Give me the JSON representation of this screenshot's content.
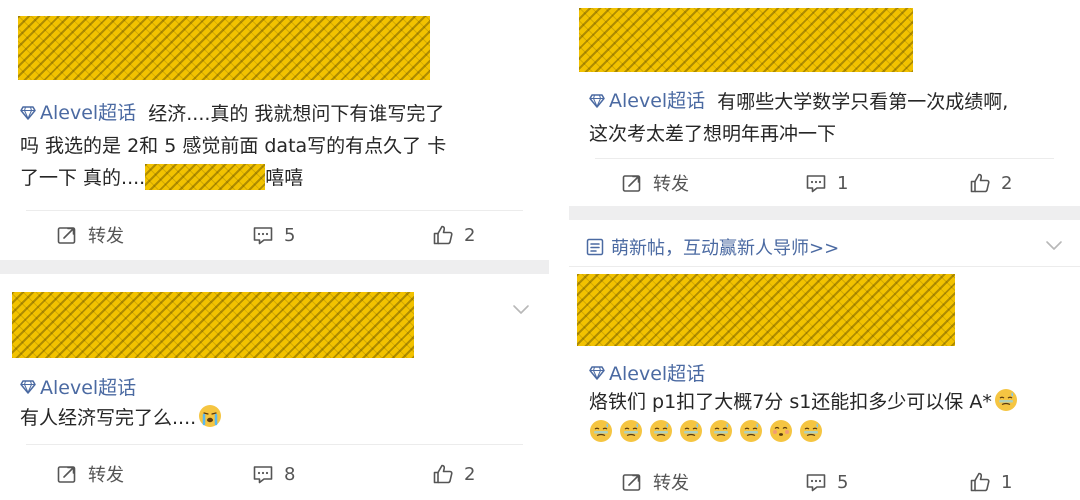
{
  "colors": {
    "topic_blue": "#4b6aa2",
    "text": "#262626",
    "action_gray": "#555555",
    "separator": "#eeeeef",
    "redaction": "#f2c200"
  },
  "posts": [
    {
      "topic": "Alevel超话",
      "line1": "经济....真的 我就想问下有谁写完了",
      "line2": "吗 我选的是 2和 5 感觉前面 data写的有点久了 卡",
      "line3_pre": "了一下 真的....",
      "line3_post": "嘻嘻",
      "repost_label": "转发",
      "comments": "5",
      "likes": "2"
    },
    {
      "topic": "Alevel超话",
      "text": "有人经济写完了么....",
      "repost_label": "转发",
      "comments": "8",
      "likes": "2"
    },
    {
      "topic": "Alevel超话",
      "line1": "有哪些大学数学只看第一次成绩啊,",
      "line2": "这次考太差了想明年再冲一下",
      "repost_label": "转发",
      "comments": "1",
      "likes": "2"
    },
    {
      "promo": "萌新帖，互动赢新人导师>>",
      "topic": "Alevel超话",
      "text": "烙铁们 p1扣了大概7分 s1还能扣多少可以保 A*",
      "repost_label": "转发",
      "comments": "5",
      "likes": "1"
    }
  ],
  "icons": {
    "topic": "diamond-icon",
    "repost": "repost-icon",
    "comment": "comment-icon",
    "like": "thumbs-up-icon",
    "more": "chevron-down-icon",
    "promo": "note-icon",
    "emoji_cry": "crying-face-icon",
    "emoji_sweat": "sweat-face-icon",
    "emoji_blush": "blushing-face-icon"
  }
}
